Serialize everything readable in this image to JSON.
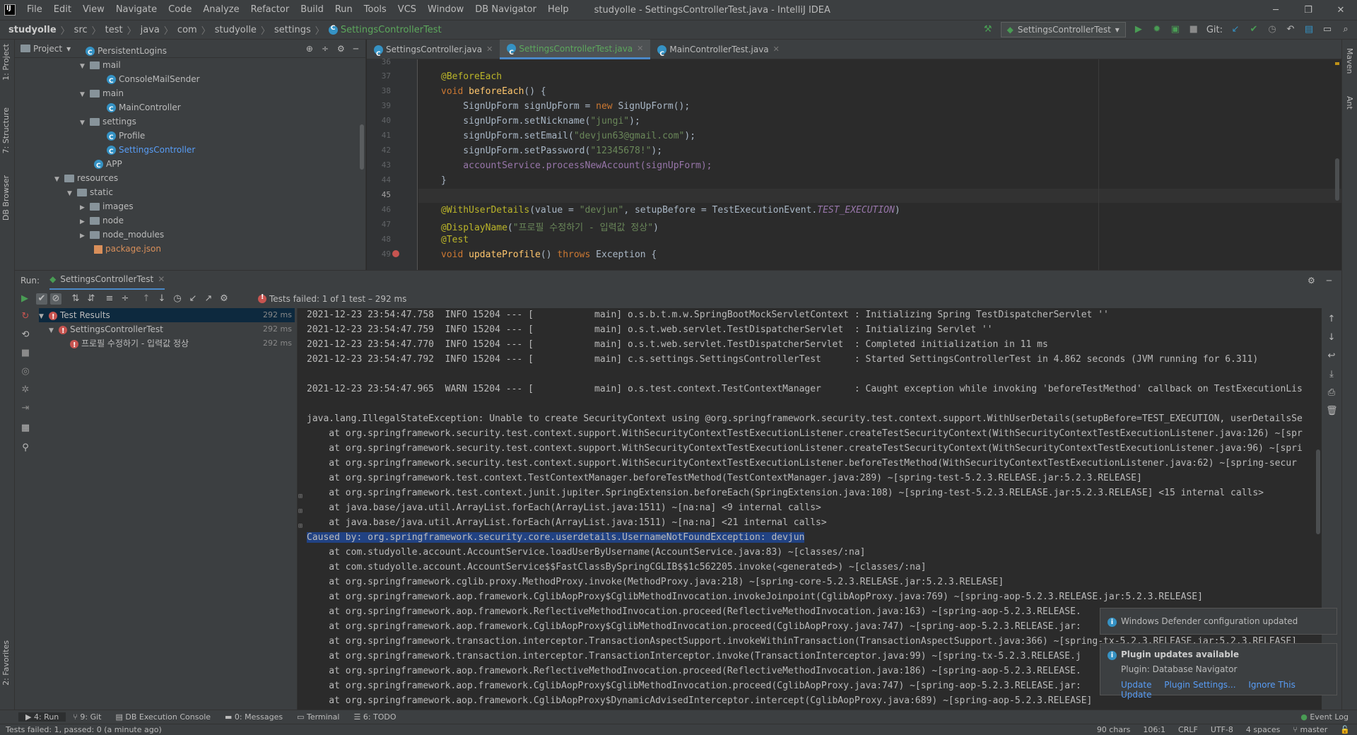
{
  "app": {
    "window_title": "studyolle - SettingsControllerTest.java - IntelliJ IDEA",
    "menu": [
      "File",
      "Edit",
      "View",
      "Navigate",
      "Code",
      "Analyze",
      "Refactor",
      "Build",
      "Run",
      "Tools",
      "VCS",
      "Window",
      "DB Navigator",
      "Help"
    ]
  },
  "breadcrumb": [
    "studyolle",
    "src",
    "test",
    "java",
    "com",
    "studyolle",
    "settings",
    "SettingsControllerTest"
  ],
  "run_config": "SettingsControllerTest",
  "git_label": "Git:",
  "left_tabs": [
    "1: Project",
    "7: Structure",
    "DB Browser",
    "2: Favorites"
  ],
  "right_tabs": [
    "Maven",
    "Ant"
  ],
  "project": {
    "header": "Project",
    "tree": [
      {
        "label": "PersistentLogins",
        "type": "class"
      },
      {
        "label": "mail",
        "type": "folder"
      },
      {
        "label": "ConsoleMailSender",
        "type": "class"
      },
      {
        "label": "main",
        "type": "folder"
      },
      {
        "label": "MainController",
        "type": "class"
      },
      {
        "label": "settings",
        "type": "folder"
      },
      {
        "label": "Profile",
        "type": "class"
      },
      {
        "label": "SettingsController",
        "type": "class-blue"
      },
      {
        "label": "APP",
        "type": "class"
      },
      {
        "label": "resources",
        "type": "folder"
      },
      {
        "label": "static",
        "type": "folder"
      },
      {
        "label": "images",
        "type": "folder"
      },
      {
        "label": "node",
        "type": "folder"
      },
      {
        "label": "node_modules",
        "type": "folder"
      },
      {
        "label": "package.json",
        "type": "file-orange"
      }
    ]
  },
  "editor": {
    "tabs": [
      {
        "label": "SettingsController.java",
        "active": false
      },
      {
        "label": "SettingsControllerTest.java",
        "active": true
      },
      {
        "label": "MainControllerTest.java",
        "active": false
      }
    ],
    "line_numbers": [
      "36",
      "37",
      "38",
      "39",
      "40",
      "41",
      "42",
      "43",
      "44",
      "45",
      "46",
      "47",
      "48",
      "49"
    ],
    "lines": {
      "l37": "@BeforeEach",
      "l38a": "void ",
      "l38b": "beforeEach",
      "l38c": "() {",
      "l39a": "    SignUpForm signUpForm = ",
      "l39b": "new",
      "l39c": " SignUpForm();",
      "l40a": "    signUpForm.setNickname(",
      "l40b": "\"jungi\"",
      "l40c": ");",
      "l41a": "    signUpForm.setEmail(",
      "l41b": "\"devjun63@gmail.com\"",
      "l41c": ");",
      "l42a": "    signUpForm.setPassword(",
      "l42b": "\"12345678!\"",
      "l42c": ");",
      "l43a": "    accountService.processNewAccount(signUpForm);",
      "l44": "}",
      "l46a": "@WithUserDetails",
      "l46b": "(value = ",
      "l46c": "\"devjun\"",
      "l46d": ", setupBefore = TestExecutionEvent.",
      "l46e": "TEST_EXECUTION",
      "l46f": ")",
      "l47a": "@DisplayName",
      "l47b": "(",
      "l47c": "\"프로필 수정하기 - 입력값 정상\"",
      "l47d": ")",
      "l48": "@Test",
      "l49a": "void ",
      "l49b": "updateProfile",
      "l49c": "() ",
      "l49d": "throws",
      "l49e": " Exception {"
    }
  },
  "run": {
    "label": "Run:",
    "tab": "SettingsControllerTest",
    "status": "Tests failed: 1 of 1 test – 292 ms",
    "tree": [
      {
        "label": "Test Results",
        "time": "292 ms"
      },
      {
        "label": "SettingsControllerTest",
        "time": "292 ms"
      },
      {
        "label": "프로필 수정하기 - 입력값 정상",
        "time": "292 ms"
      }
    ],
    "console": [
      "2021-12-23 23:54:47.758  INFO 15204 --- [           main] o.s.b.t.m.w.SpringBootMockServletContext : Initializing Spring TestDispatcherServlet ''",
      "2021-12-23 23:54:47.759  INFO 15204 --- [           main] o.s.t.web.servlet.TestDispatcherServlet  : Initializing Servlet ''",
      "2021-12-23 23:54:47.770  INFO 15204 --- [           main] o.s.t.web.servlet.TestDispatcherServlet  : Completed initialization in 11 ms",
      "2021-12-23 23:54:47.792  INFO 15204 --- [           main] c.s.settings.SettingsControllerTest      : Started SettingsControllerTest in 4.862 seconds (JVM running for 6.311)",
      "",
      "2021-12-23 23:54:47.965  WARN 15204 --- [           main] o.s.test.context.TestContextManager      : Caught exception while invoking 'beforeTestMethod' callback on TestExecutionLis",
      "",
      "java.lang.IllegalStateException: Unable to create SecurityContext using @org.springframework.security.test.context.support.WithUserDetails(setupBefore=TEST_EXECUTION, userDetailsSe",
      "    at org.springframework.security.test.context.support.WithSecurityContextTestExecutionListener.createTestSecurityContext(WithSecurityContextTestExecutionListener.java:126) ~[spr",
      "    at org.springframework.security.test.context.support.WithSecurityContextTestExecutionListener.createTestSecurityContext(WithSecurityContextTestExecutionListener.java:96) ~[spri",
      "    at org.springframework.security.test.context.support.WithSecurityContextTestExecutionListener.beforeTestMethod(WithSecurityContextTestExecutionListener.java:62) ~[spring-secur",
      "    at org.springframework.test.context.TestContextManager.beforeTestMethod(TestContextManager.java:289) ~[spring-test-5.2.3.RELEASE.jar:5.2.3.RELEASE]",
      "    at org.springframework.test.context.junit.jupiter.SpringExtension.beforeEach(SpringExtension.java:108) ~[spring-test-5.2.3.RELEASE.jar:5.2.3.RELEASE] <15 internal calls>",
      "    at java.base/java.util.ArrayList.forEach(ArrayList.java:1511) ~[na:na] <9 internal calls>",
      "    at java.base/java.util.ArrayList.forEach(ArrayList.java:1511) ~[na:na] <21 internal calls>",
      "Caused by: org.springframework.security.core.userdetails.UsernameNotFoundException: devjun",
      "    at com.studyolle.account.AccountService.loadUserByUsername(AccountService.java:83) ~[classes/:na]",
      "    at com.studyolle.account.AccountService$$FastClassBySpringCGLIB$$1c562205.invoke(<generated>) ~[classes/:na]",
      "    at org.springframework.cglib.proxy.MethodProxy.invoke(MethodProxy.java:218) ~[spring-core-5.2.3.RELEASE.jar:5.2.3.RELEASE]",
      "    at org.springframework.aop.framework.CglibAopProxy$CglibMethodInvocation.invokeJoinpoint(CglibAopProxy.java:769) ~[spring-aop-5.2.3.RELEASE.jar:5.2.3.RELEASE]",
      "    at org.springframework.aop.framework.ReflectiveMethodInvocation.proceed(ReflectiveMethodInvocation.java:163) ~[spring-aop-5.2.3.RELEASE.",
      "    at org.springframework.aop.framework.CglibAopProxy$CglibMethodInvocation.proceed(CglibAopProxy.java:747) ~[spring-aop-5.2.3.RELEASE.jar:",
      "    at org.springframework.transaction.interceptor.TransactionAspectSupport.invokeWithinTransaction(TransactionAspectSupport.java:366) ~[spring-tx-5.2.3.RELEASE.jar:5.2.3.RELEASE]",
      "    at org.springframework.transaction.interceptor.TransactionInterceptor.invoke(TransactionInterceptor.java:99) ~[spring-tx-5.2.3.RELEASE.j",
      "    at org.springframework.aop.framework.ReflectiveMethodInvocation.proceed(ReflectiveMethodInvocation.java:186) ~[spring-aop-5.2.3.RELEASE.",
      "    at org.springframework.aop.framework.CglibAopProxy$CglibMethodInvocation.proceed(CglibAopProxy.java:747) ~[spring-aop-5.2.3.RELEASE.jar:",
      "    at org.springframework.aop.framework.CglibAopProxy$DynamicAdvisedInterceptor.intercept(CglibAopProxy.java:689) ~[spring-aop-5.2.3.RELEASE]"
    ]
  },
  "notifications": [
    {
      "title": "Windows Defender configuration updated"
    },
    {
      "title": "Plugin updates available",
      "body": "Plugin: Database Navigator",
      "links": [
        "Update",
        "Plugin Settings...",
        "Ignore This Update"
      ]
    }
  ],
  "bottom_tabs": [
    "4: Run",
    "9: Git",
    "DB Execution Console",
    "0: Messages",
    "Terminal",
    "6: TODO"
  ],
  "event_log": "Event Log",
  "status": {
    "message": "Tests failed: 1, passed: 0 (a minute ago)",
    "chars": "90 chars",
    "position": "106:1",
    "line_sep": "CRLF",
    "encoding": "UTF-8",
    "indent": "4 spaces",
    "branch": "master"
  }
}
